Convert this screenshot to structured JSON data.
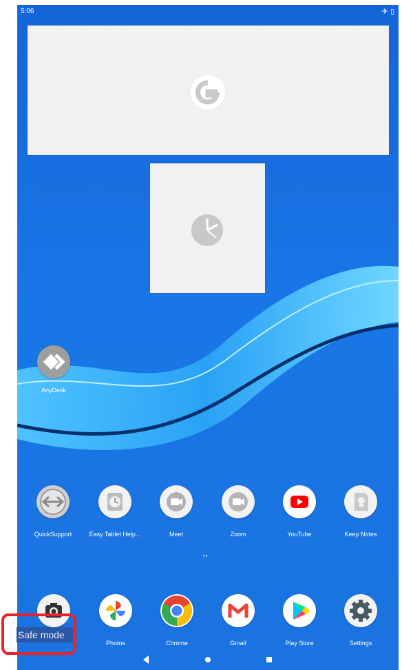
{
  "status_bar": {
    "time": "5:06",
    "icons": [
      "airplane-icon",
      "battery-icon"
    ]
  },
  "widgets": [
    {
      "name": "google-search-widget",
      "icon": "google-g-icon"
    },
    {
      "name": "analog-clock-widget",
      "icon": "clock-icon"
    }
  ],
  "desktop_apps": [
    {
      "label": "AnyDesk",
      "icon": "anydesk-icon"
    }
  ],
  "app_row": [
    {
      "label": "QuickSupport",
      "icon": "quicksupport-icon"
    },
    {
      "label": "Easy Tablet Help...",
      "icon": "easy-tablet-help-icon"
    },
    {
      "label": "Meet",
      "icon": "meet-icon"
    },
    {
      "label": "Zoom",
      "icon": "zoom-icon"
    },
    {
      "label": "YouTube",
      "icon": "youtube-icon"
    },
    {
      "label": "Keep Notes",
      "icon": "keep-notes-icon"
    }
  ],
  "dock": [
    {
      "label": "",
      "icon": "camera-icon"
    },
    {
      "label": "Photos",
      "icon": "photos-icon"
    },
    {
      "label": "Chrome",
      "icon": "chrome-icon"
    },
    {
      "label": "Gmail",
      "icon": "gmail-icon"
    },
    {
      "label": "Play Store",
      "icon": "play-store-icon"
    },
    {
      "label": "Settings",
      "icon": "settings-icon"
    }
  ],
  "page_indicator": "••",
  "navigation": [
    "back-icon",
    "home-icon",
    "recents-icon"
  ],
  "safe_mode": {
    "label": "Safe mode",
    "highlight_color": "#e8232a"
  },
  "colors": {
    "wallpaper": "#1976e6",
    "widget_bg": "#f1f1f1"
  }
}
